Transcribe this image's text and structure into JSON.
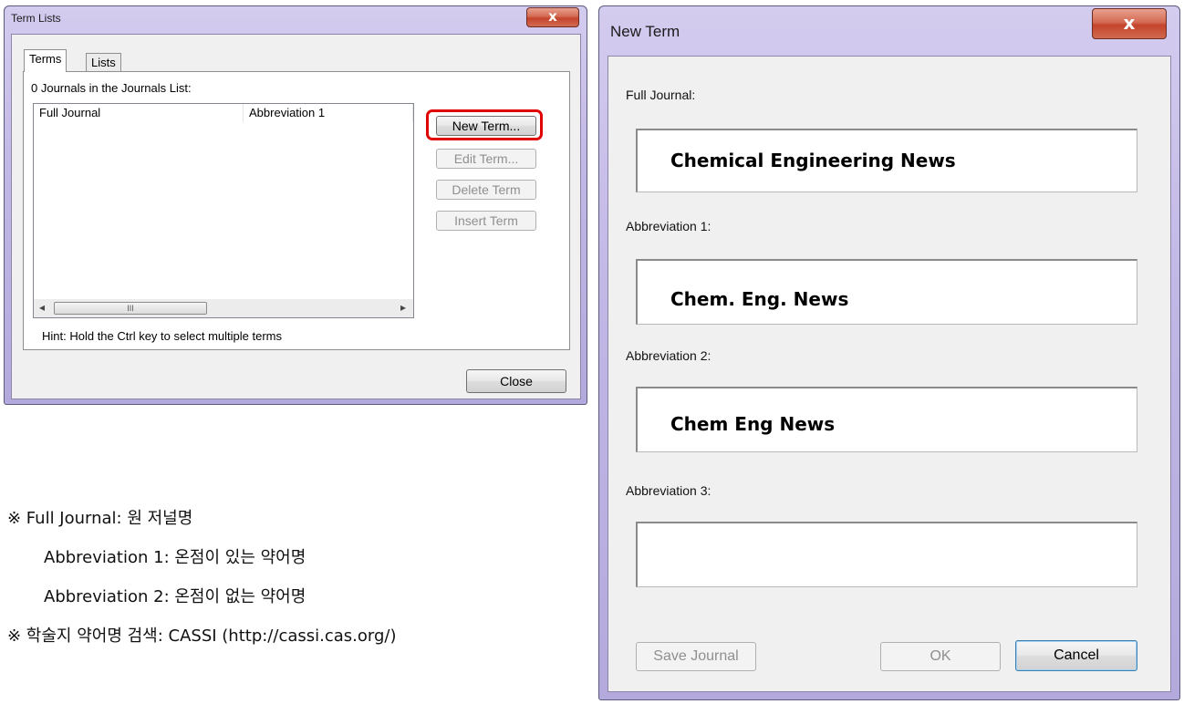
{
  "term_lists": {
    "title": "Term Lists",
    "close_glyph": "x",
    "tabs": [
      "Terms",
      "Lists"
    ],
    "count_label": "0 Journals in the Journals List:",
    "columns": [
      "Full Journal",
      "Abbreviation 1"
    ],
    "scroll_thumb": "III",
    "scroll_left": "◂",
    "scroll_right": "▸",
    "buttons": {
      "new_term": "New Term...",
      "edit_term": "Edit Term...",
      "delete_term": "Delete Term",
      "insert_term": "Insert Term",
      "close": "Close"
    },
    "hint": "Hint: Hold the Ctrl key to select multiple terms",
    "highlight_color": "#e00000"
  },
  "new_term": {
    "title": "New Term",
    "close_glyph": "x",
    "fields": [
      {
        "label": "Full Journal:",
        "value": "Chemical Engineering News"
      },
      {
        "label": "Abbreviation 1:",
        "value": "Chem. Eng. News"
      },
      {
        "label": "Abbreviation 2:",
        "value": "Chem Eng News"
      },
      {
        "label": "Abbreviation 3:",
        "value": ""
      }
    ],
    "buttons": {
      "save_journal": "Save Journal",
      "ok": "OK",
      "cancel": "Cancel"
    }
  },
  "notes": [
    "※ Full Journal:  원  저널명",
    "Abbreviation 1:  온점이  있는  약어명",
    "Abbreviation 2:  온점이  없는  약어명",
    "※  학술지  약어명  검색: CASSI (http://cassi.cas.org/)"
  ]
}
